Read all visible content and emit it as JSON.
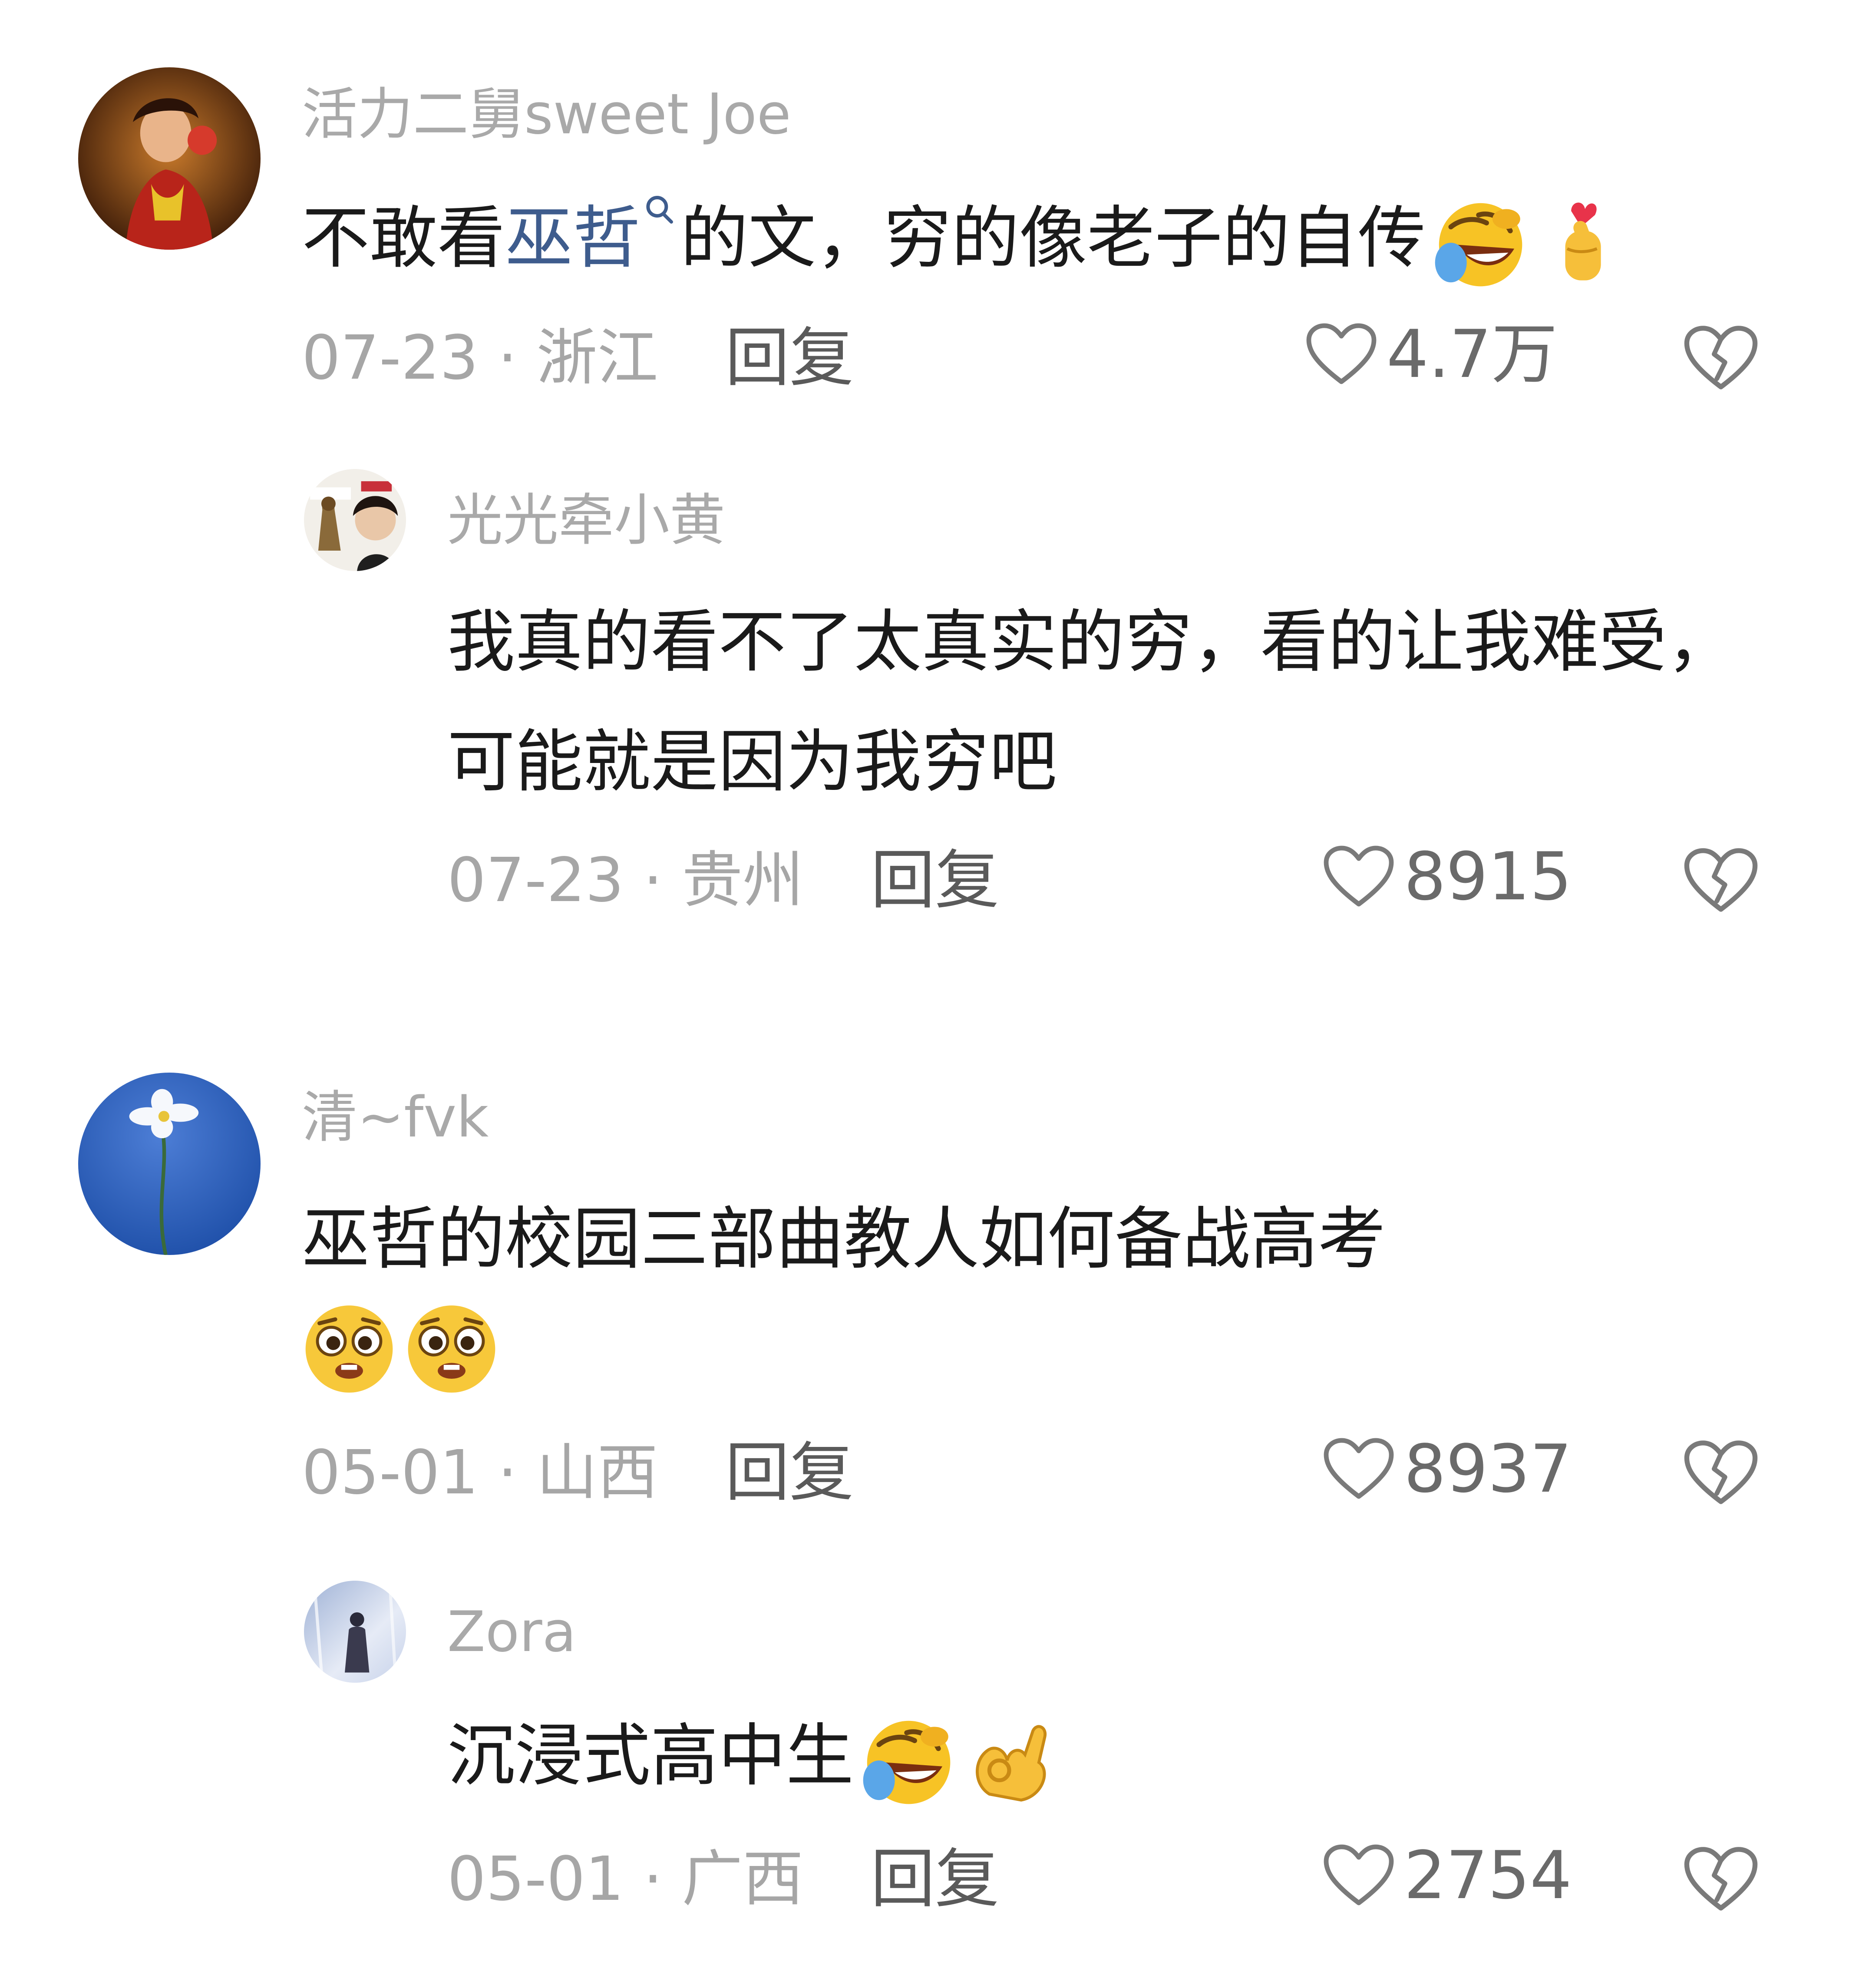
{
  "comments": [
    {
      "username": "活力二舅sweet Joe",
      "text_before": "不敢看",
      "link_text": "巫哲",
      "text_after": "的文，穷的像老子的自传",
      "emojis": [
        "rofl-emoji",
        "finger-heart-emoji"
      ],
      "date_location": "07-23 · 浙江",
      "reply_label": "回复",
      "like_count": "4.7万",
      "replies": [
        {
          "username": "光光牵小黄",
          "text": "我真的看不了太真实的穷，看的让我难受，可能就是因为我穷吧",
          "date_location": "07-23 · 贵州",
          "reply_label": "回复",
          "like_count": "8915"
        }
      ]
    },
    {
      "username": "清~fvk",
      "text": "巫哲的校园三部曲教人如何备战高考",
      "emojis": [
        "pleading-emoji",
        "pleading-emoji"
      ],
      "date_location": "05-01 · 山西",
      "reply_label": "回复",
      "like_count": "8937",
      "replies": [
        {
          "username": "Zora",
          "text": "沉浸式高中生",
          "emojis": [
            "rofl-emoji",
            "ok-hand-emoji"
          ],
          "date_location": "05-01 · 广西",
          "reply_label": "回复",
          "like_count": "2754"
        }
      ]
    }
  ],
  "colors": {
    "username": "#a9a9a9",
    "text": "#1a1a1a",
    "link": "#3e5c8d",
    "meta": "#a6a6a6",
    "icon": "#7a7a7a"
  }
}
